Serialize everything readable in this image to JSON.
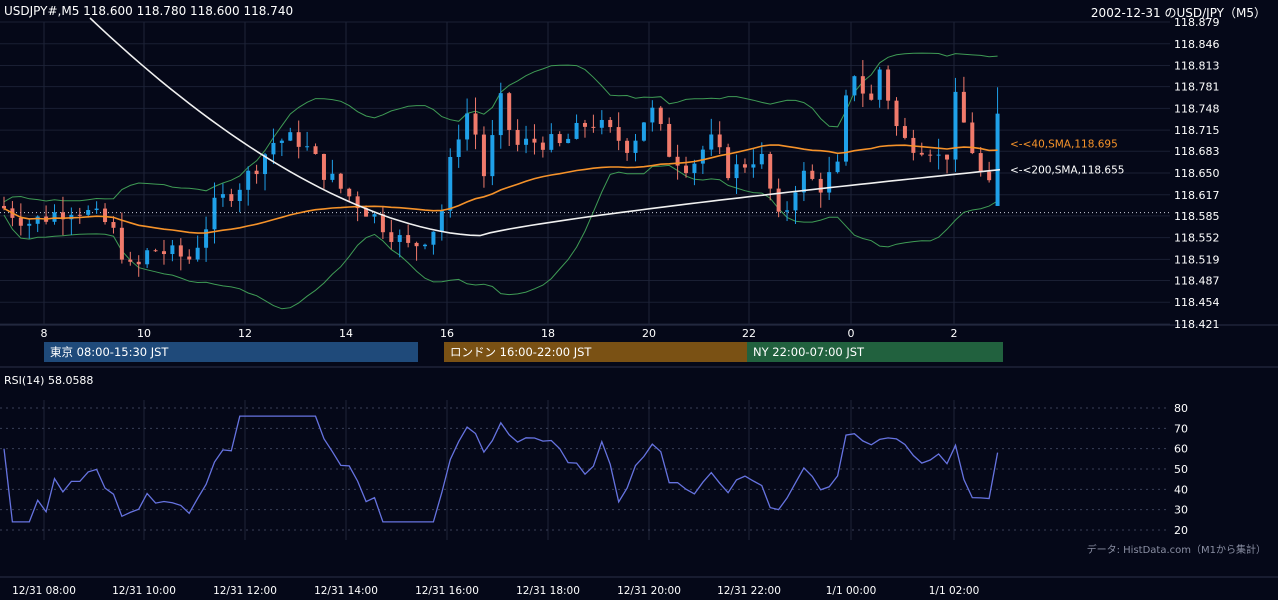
{
  "header": {
    "instrument": "USDJPY#,M5 118.600 118.780 118.600 118.740",
    "title": "2002-12-31 のUSD/JPY（M5）"
  },
  "price_axis": {
    "ticks": [
      "118.879",
      "118.846",
      "118.813",
      "118.781",
      "118.748",
      "118.715",
      "118.683",
      "118.650",
      "118.617",
      "118.585",
      "118.552",
      "118.519",
      "118.487",
      "118.454",
      "118.421"
    ]
  },
  "x_axis_top": {
    "ticks": [
      "8",
      "10",
      "12",
      "14",
      "16",
      "18",
      "20",
      "22",
      "0",
      "2"
    ]
  },
  "x_axis_bottom": {
    "ticks": [
      "12/31 08:00",
      "12/31 10:00",
      "12/31 12:00",
      "12/31 14:00",
      "12/31 16:00",
      "12/31 18:00",
      "12/31 20:00",
      "12/31 22:00",
      "1/1 00:00",
      "1/1 02:00"
    ]
  },
  "ma_labels": {
    "sma40": "<-<40,SMA,118.695",
    "sma200": "<-<200,SMA,118.655"
  },
  "sessions": [
    {
      "label": "東京 08:00-15:30 JST",
      "color": "#1f4a7a"
    },
    {
      "label": "ロンドン 16:00-22:00 JST",
      "color": "#7a5114"
    },
    {
      "label": "NY 22:00-07:00 JST",
      "color": "#21613e"
    }
  ],
  "rsi": {
    "label": "RSI(14) 58.0588",
    "ticks": [
      "80",
      "70",
      "60",
      "50",
      "40",
      "30",
      "20"
    ]
  },
  "source_note": "データ: HistData.com（M1から集計）",
  "colors": {
    "background": "#050818",
    "up": "#1fa0e8",
    "down": "#f07a6b",
    "sma40": "#f5922a",
    "sma200": "#f0f0f0",
    "bollinger": "#3f9b55",
    "rsi_line": "#6673e0"
  },
  "chart_data": [
    {
      "type": "candlestick",
      "title": "2002-12-31 のUSD/JPY（M5）",
      "xlabel": "",
      "ylabel": "",
      "ylim": [
        118.421,
        118.879
      ],
      "x_range": [
        "12/31 07:00",
        "1/1 02:55"
      ],
      "last_bar": {
        "open": 118.6,
        "high": 118.78,
        "low": 118.6,
        "close": 118.74
      },
      "series": [
        {
          "name": "40,SMA",
          "last_value": 118.695
        },
        {
          "name": "200,SMA",
          "last_value": 118.655
        }
      ],
      "reference_line": 118.59,
      "grid": true
    },
    {
      "type": "line",
      "title": "RSI(14) 58.0588",
      "ylim": [
        20,
        80
      ],
      "grid": true,
      "series": [
        {
          "name": "RSI(14)",
          "last_value": 58.0588
        }
      ]
    }
  ]
}
